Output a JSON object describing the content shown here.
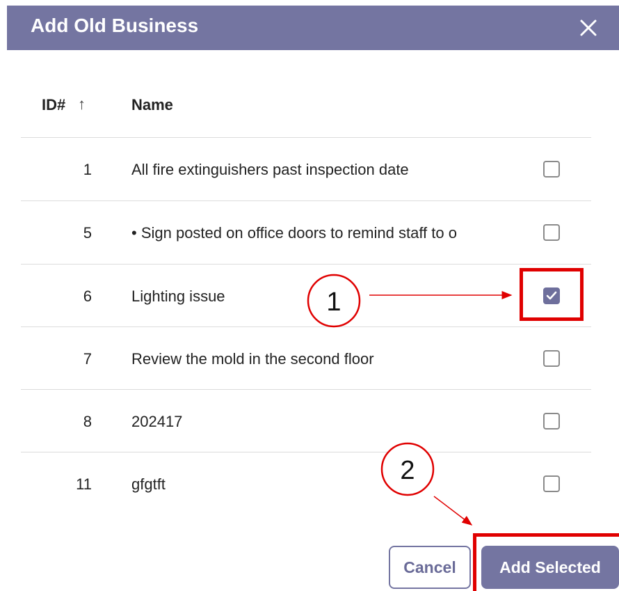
{
  "dialog": {
    "title": "Add Old Business",
    "close_icon": "close-icon"
  },
  "table": {
    "columns": {
      "id": "ID#",
      "sort_icon": "arrow-up-icon",
      "name": "Name"
    },
    "rows": [
      {
        "id": "1",
        "name": "All fire extinguishers past inspection date",
        "checked": false
      },
      {
        "id": "5",
        "name": "• Sign posted on office doors to remind staff to o",
        "checked": false
      },
      {
        "id": "6",
        "name": "Lighting issue",
        "checked": true
      },
      {
        "id": "7",
        "name": "Review the mold in the second floor",
        "checked": false
      },
      {
        "id": "8",
        "name": "202417",
        "checked": false
      },
      {
        "id": "11",
        "name": "gfgtft",
        "checked": false
      }
    ]
  },
  "buttons": {
    "cancel": "Cancel",
    "add_selected": "Add Selected"
  },
  "annotations": {
    "step1": "1",
    "step2": "2"
  },
  "colors": {
    "header": "#7475a1",
    "checkbox_checked": "#6e6f9c",
    "annotation": "#e00000"
  }
}
